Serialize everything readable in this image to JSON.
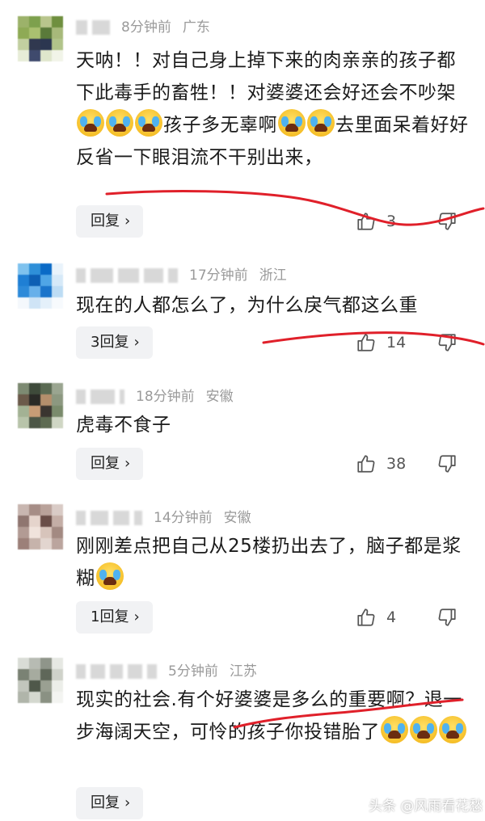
{
  "comments": [
    {
      "time": "8分钟前",
      "location": "广东",
      "text_parts": [
        "天呐！！对自己身上掉下来的肉亲亲的孩子都下此毒手的畜牲！！对婆婆还会好还会不吵架",
        "孩子多无辜啊",
        "去里面呆着好好反省一下眼泪流不干别出来，"
      ],
      "reply_label": "回复",
      "likes": "3"
    },
    {
      "time": "17分钟前",
      "location": "浙江",
      "text": "现在的人都怎么了，为什么戾气都这么重",
      "reply_label": "3回复",
      "likes": "14"
    },
    {
      "time": "18分钟前",
      "location": "安徽",
      "text": "虎毒不食子",
      "reply_label": "回复",
      "likes": "38"
    },
    {
      "time": "14分钟前",
      "location": "安徽",
      "text": "刚刚差点把自己从25楼扔出去了，脑子都是浆糊",
      "reply_label": "1回复",
      "likes": "4"
    },
    {
      "time": "5分钟前",
      "location": "江苏",
      "text": "现实的社会.有个好婆婆是多么的重要啊？退一步海阔天空，可怜的孩子你投错胎了",
      "reply_label": "回复",
      "likes": ""
    }
  ],
  "icons": {
    "emoji": "loudly-crying-face-icon",
    "like": "thumbs-up-icon",
    "dislike": "thumbs-down-icon",
    "chevron": "chevron-right-icon"
  },
  "chevron": "›",
  "watermark": "头条 @风雨看花愁",
  "colors": {
    "annotation": "#e0202a",
    "meta": "#9a9a9a",
    "reply_bg": "#f1f2f4"
  }
}
